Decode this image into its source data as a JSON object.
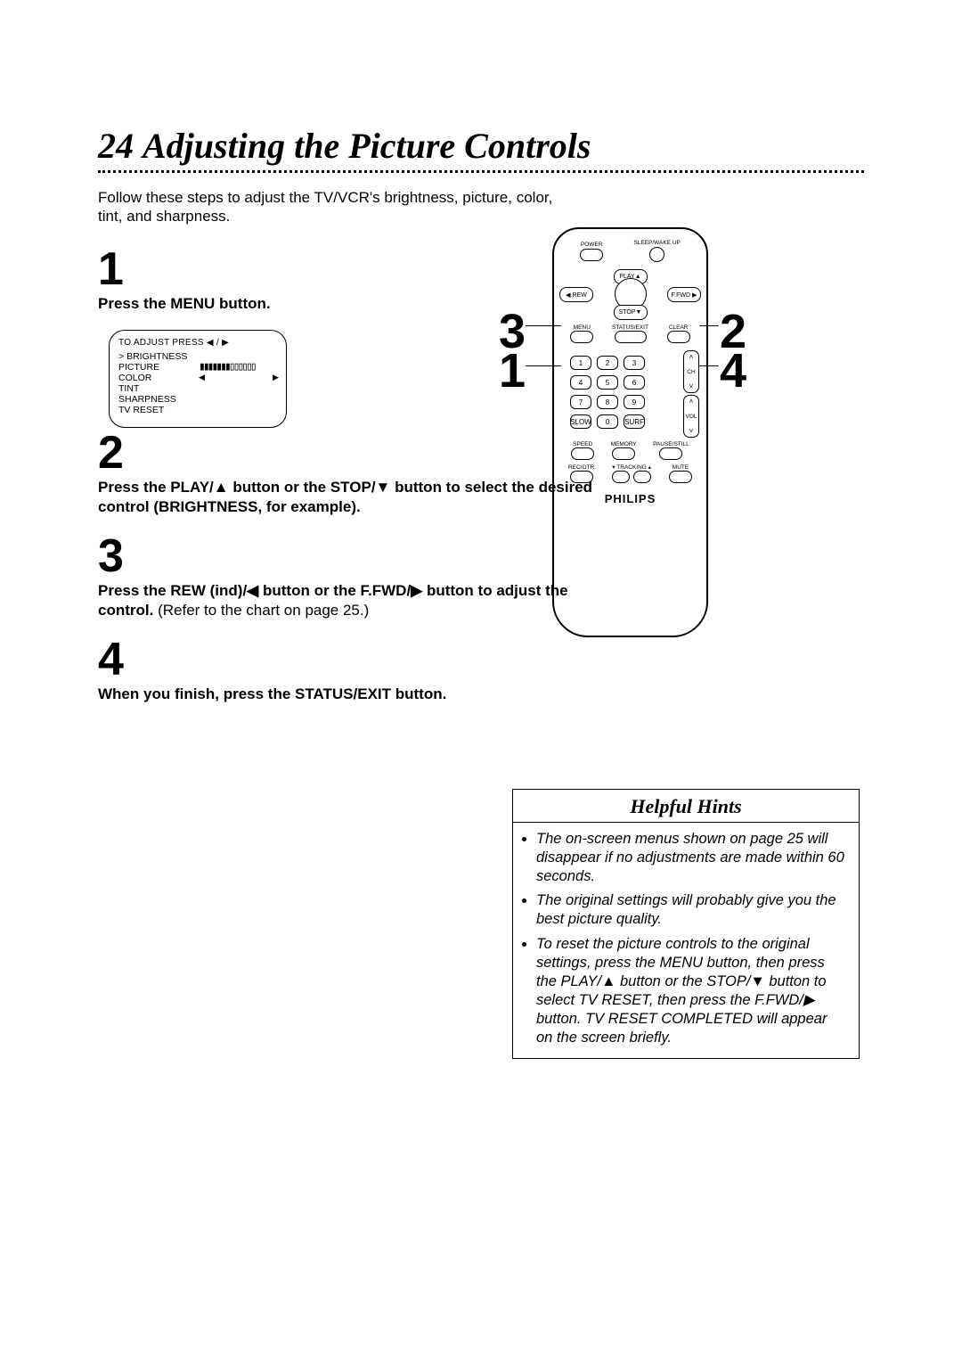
{
  "page_number": "24",
  "title": "Adjusting the Picture Controls",
  "intro": "Follow these steps to adjust the TV/VCR's brightness, picture, color, tint, and sharpness.",
  "tv_menu": {
    "header": "TO ADJUST PRESS ◀ / ▶",
    "items": [
      "BRIGHTNESS",
      "PICTURE",
      "COLOR",
      "TINT",
      "SHARPNESS",
      "TV RESET"
    ],
    "slider_left": "◀",
    "slider_right": "▶"
  },
  "steps": {
    "s1_num": "1",
    "s1_text": "Press the MENU button.",
    "s2_num": "2",
    "s2_bold": "Press the PLAY/▲ button or the STOP/▼ button to select the desired control (BRIGHTNESS, for example).",
    "s3_num": "3",
    "s3_bold": "Press the REW (ind)/◀ button or the F.FWD/▶ button to adjust the control.",
    "s3_tail": " (Refer to the chart on page 25.)",
    "s4_num": "4",
    "s4_text": "When you finish, press the STATUS/EXIT button."
  },
  "remote": {
    "power": "POWER",
    "sleep": "SLEEP/WAKE UP",
    "play": "PLAY▲",
    "rew": "◀ REW",
    "ffwd": "F.FWD ▶",
    "stop": "STOP▼",
    "menu": "MENU",
    "status": "STATUS/EXIT",
    "clear": "CLEAR",
    "slow": "SLOW",
    "surf": "SURF",
    "ch": "CH",
    "vol": "VOL",
    "speed": "SPEED",
    "memory": "MEMORY",
    "pause": "PAUSE/STILL",
    "rec": "REC/OTR",
    "tracking": "▾ TRACKING ▴",
    "mute": "MUTE",
    "brand": "PHILIPS",
    "nums": [
      "1",
      "2",
      "3",
      "4",
      "5",
      "6",
      "7",
      "8",
      "9",
      "0"
    ]
  },
  "callouts": {
    "c1": "1",
    "c2": "2",
    "c3": "3",
    "c4": "4"
  },
  "hints": {
    "title": "Helpful Hints",
    "items": [
      "The on-screen menus shown on page 25 will disappear if no adjustments are made within 60 seconds.",
      "The original settings will probably give you the best picture quality.",
      "To reset the picture controls to the original settings, press the MENU button, then press the PLAY/▲ button or the STOP/▼ button to select TV RESET, then press the F.FWD/▶ button. TV RESET COMPLETED will appear on the screen briefly."
    ]
  }
}
